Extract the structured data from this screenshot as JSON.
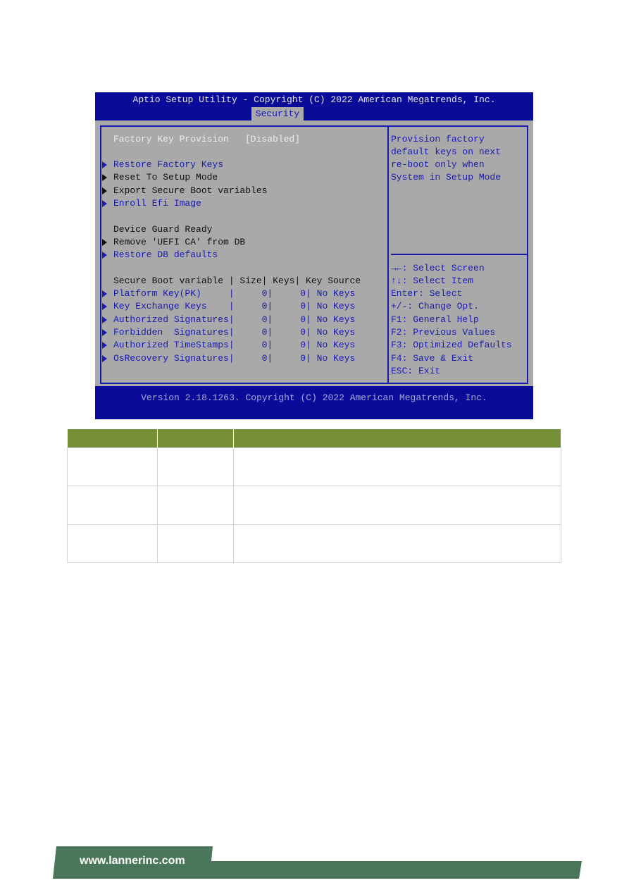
{
  "bios": {
    "title": "Aptio Setup Utility - Copyright (C) 2022 American Megatrends, Inc.",
    "active_tab": "Security",
    "version": "Version 2.18.1263. Copyright (C) 2022 American Megatrends, Inc.",
    "factory_key_provision": {
      "label": "Factory Key Provision",
      "value": "[Disabled]"
    },
    "menu": [
      {
        "label": "Restore Factory Keys"
      },
      {
        "label": "Reset To Setup Mode"
      },
      {
        "label": "Export Secure Boot variables"
      },
      {
        "label": "Enroll Efi Image"
      },
      {
        "label": "Device Guard Ready"
      },
      {
        "label": "Remove 'UEFI CA' from DB"
      },
      {
        "label": "Restore DB defaults"
      }
    ],
    "variables_header": "Secure Boot variable | Size| Keys| Key Source",
    "variables": [
      "Platform Key(PK)     |     0|     0| No Keys",
      "Key Exchange Keys    |     0|     0| No Keys",
      "Authorized Signatures|     0|     0| No Keys",
      "Forbidden  Signatures|     0|     0| No Keys",
      "Authorized TimeStamps|     0|     0| No Keys",
      "OsRecovery Signatures|     0|     0| No Keys"
    ],
    "help": [
      "Provision factory",
      "default keys on next",
      "re-boot only when",
      "System in Setup Mode"
    ],
    "keys": [
      "→←: Select Screen",
      "↑↓: Select Item",
      "Enter: Select",
      "+/-: Change Opt.",
      "F1: General Help",
      "F2: Previous Values",
      "F3: Optimized Defaults",
      "F4: Save & Exit",
      "ESC: Exit"
    ],
    "colors": {
      "band": "#0b0b99",
      "background": "#a9a9a9",
      "highlight_text": "#1a1ab4"
    }
  },
  "table": {
    "header_color": "#76903a"
  },
  "footer": {
    "url": "www.lannerinc.com",
    "color": "#4a7759"
  }
}
